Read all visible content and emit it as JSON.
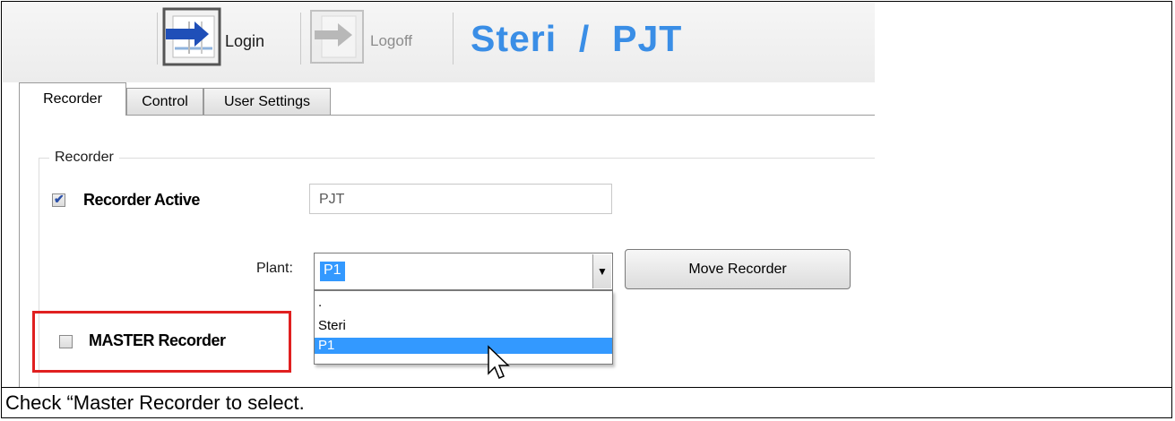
{
  "toolbar": {
    "login_label": "Login",
    "logoff_label": "Logoff",
    "title": "Steri  /  PJT",
    "title_color": "#3a8ee6"
  },
  "tabs": [
    {
      "label": "Recorder",
      "active": true
    },
    {
      "label": "Control",
      "active": false
    },
    {
      "label": "User Settings",
      "active": false
    }
  ],
  "recorder_group": {
    "title": "Recorder",
    "recorder_active_label": "Recorder Active",
    "recorder_active_checked": true,
    "recorder_name_value": "PJT",
    "plant_label": "Plant:",
    "plant_selected": "P1",
    "move_button_label": "Move Recorder",
    "plant_options": [
      ".",
      "Steri",
      "P1"
    ],
    "master_recorder_label": "MASTER Recorder",
    "master_recorder_checked": false
  },
  "caption": "Check “Master Recorder to select.",
  "colors": {
    "highlight": "#e02020",
    "selection": "#3399ff"
  },
  "icons": {
    "login": "login-arrow-icon",
    "logoff": "logoff-arrow-icon",
    "dropdown": "chevron-down-icon",
    "cursor": "mouse-pointer-icon",
    "check": "checkmark-icon"
  }
}
